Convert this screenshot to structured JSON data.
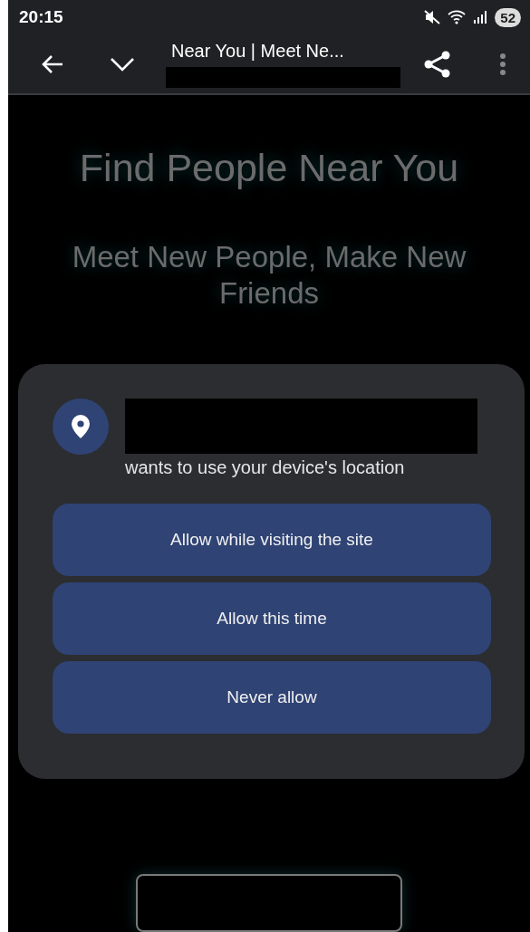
{
  "status_bar": {
    "time": "20:15",
    "battery": "52"
  },
  "toolbar": {
    "title": "Near You | Meet Ne..."
  },
  "page": {
    "heading": "Find People Near You",
    "subheading": "Meet New People, Make New Friends"
  },
  "permission_dialog": {
    "message": "wants to use your device's location",
    "buttons": [
      {
        "label": "Allow while visiting the site"
      },
      {
        "label": "Allow this time"
      },
      {
        "label": "Never allow"
      }
    ]
  }
}
